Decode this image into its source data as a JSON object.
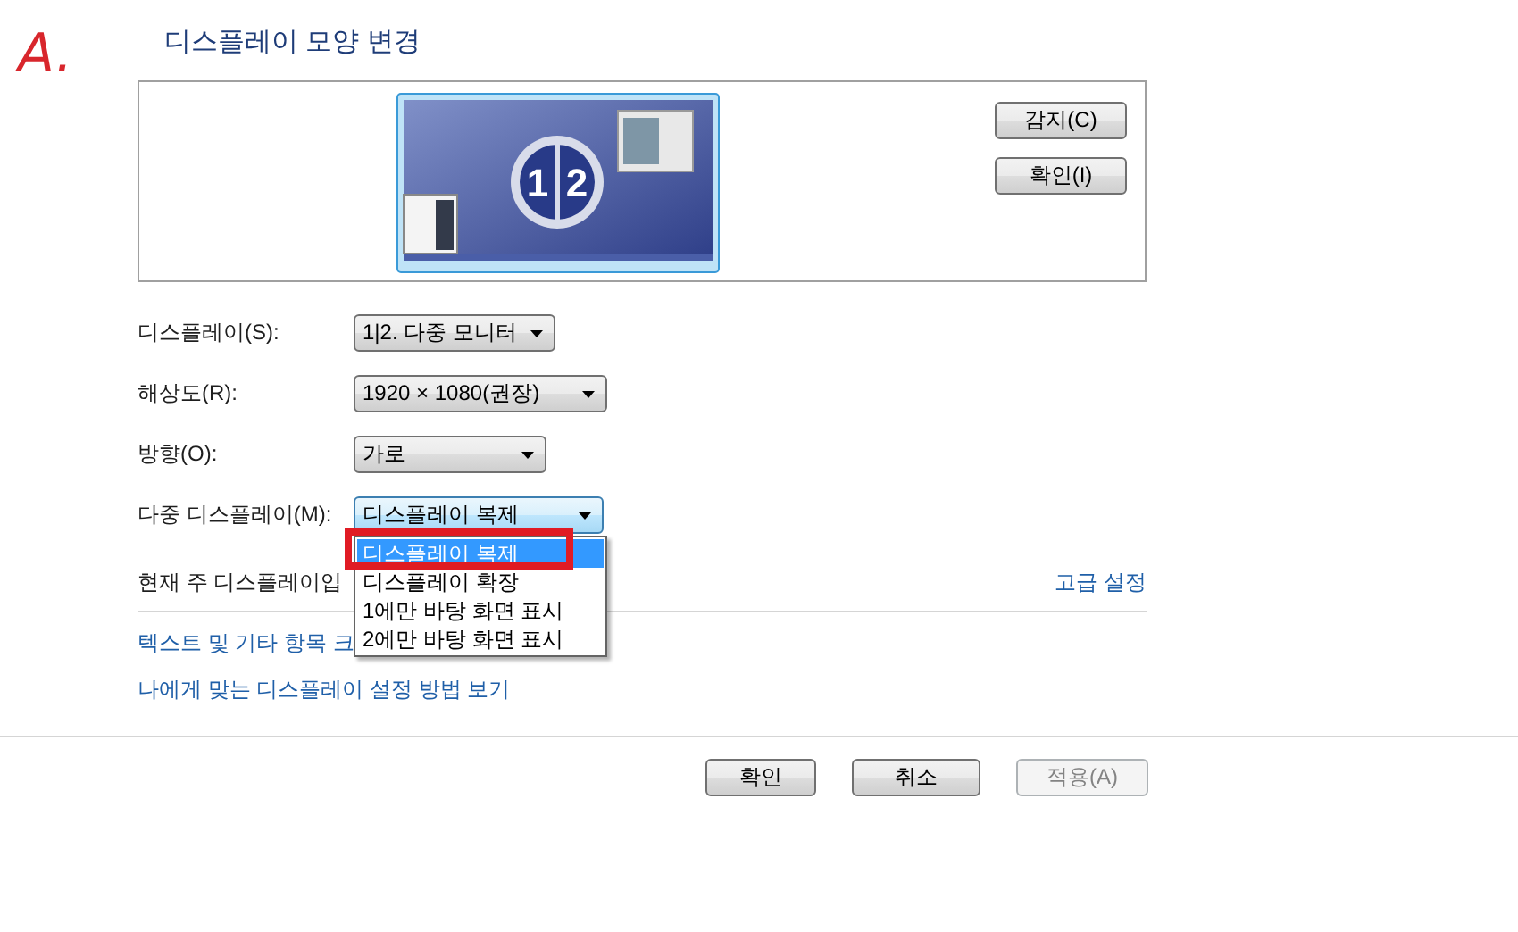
{
  "annotation": "A.",
  "title": "디스플레이 모양 변경",
  "preview": {
    "numbers": [
      "1",
      "2"
    ],
    "buttons": [
      {
        "label": "감지(C)"
      },
      {
        "label": "확인(I)"
      }
    ]
  },
  "settings": [
    {
      "label": "디스플레이(S):",
      "value": "1|2. 다중 모니터",
      "focused": false
    },
    {
      "label": "해상도(R):",
      "value": "1920 × 1080(권장)",
      "focused": false
    },
    {
      "label": "방향(O):",
      "value": "가로",
      "focused": false
    },
    {
      "label": "다중 디스플레이(M):",
      "value": "디스플레이 복제",
      "focused": true,
      "options": [
        {
          "label": "디스플레이 복제",
          "selected": true,
          "highlighted": true
        },
        {
          "label": "디스플레이 확장",
          "selected": false,
          "highlighted": false
        },
        {
          "label": "1에만 바탕 화면 표시",
          "selected": false,
          "highlighted": false
        },
        {
          "label": "2에만 바탕 화면 표시",
          "selected": false,
          "highlighted": false
        }
      ]
    }
  ],
  "primary_note": "현재 주 디스플레이입",
  "advanced_link": "고급 설정",
  "links": [
    "텍스트 및 기타 항목 크",
    "나에게 맞는 디스플레이 설정 방법 보기"
  ],
  "buttons": [
    {
      "label": "확인",
      "disabled": false
    },
    {
      "label": "취소",
      "disabled": false
    },
    {
      "label": "적용(A)",
      "disabled": true
    }
  ]
}
